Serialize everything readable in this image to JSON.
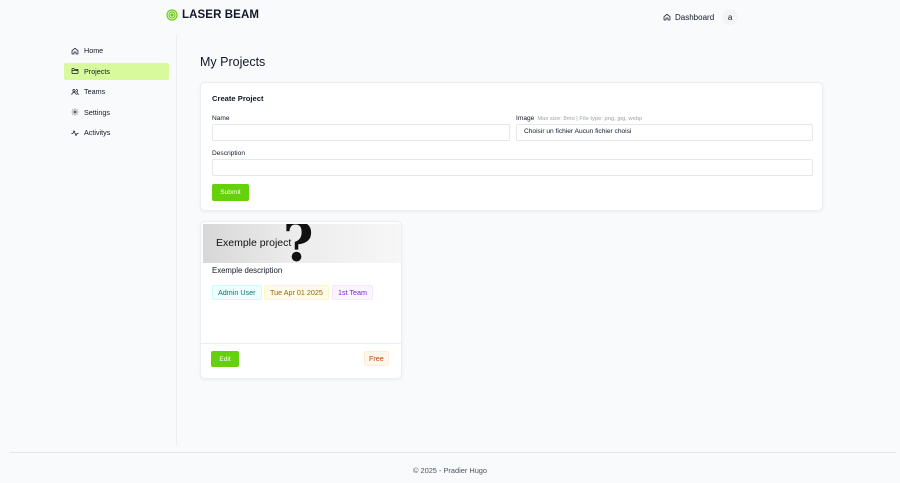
{
  "header": {
    "brand": "LASER BEAM",
    "dashboard_label": "Dashboard",
    "avatar_initial": "a"
  },
  "sidebar": {
    "items": [
      {
        "label": "Home",
        "icon": "home-icon"
      },
      {
        "label": "Projects",
        "icon": "folder-icon",
        "active": true
      },
      {
        "label": "Teams",
        "icon": "users-icon"
      },
      {
        "label": "Settings",
        "icon": "gear-icon"
      },
      {
        "label": "Activitys",
        "icon": "activity-icon"
      }
    ]
  },
  "main": {
    "title": "My Projects",
    "create_form": {
      "title": "Create Project",
      "name_label": "Name",
      "name_value": "",
      "image_label": "Image",
      "image_hint": "Max size: 8mo | File type: png, jpg, webp",
      "file_button": "Choisir un fichier",
      "file_status": "Aucun fichier choisi",
      "description_label": "Description",
      "description_value": "",
      "submit_label": "Submit"
    },
    "projects": [
      {
        "name": "Exemple project",
        "description": "Exemple description",
        "owner": "Admin User",
        "date": "Tue Apr 01 2025",
        "team": "1st Team",
        "edit_label": "Edit",
        "plan": "Free"
      }
    ]
  },
  "footer": {
    "text": "© 2025 - Pradier Hugo"
  },
  "colors": {
    "accent": "#65d10b",
    "active_nav": "#d9f99d",
    "background": "#f9fafb"
  }
}
